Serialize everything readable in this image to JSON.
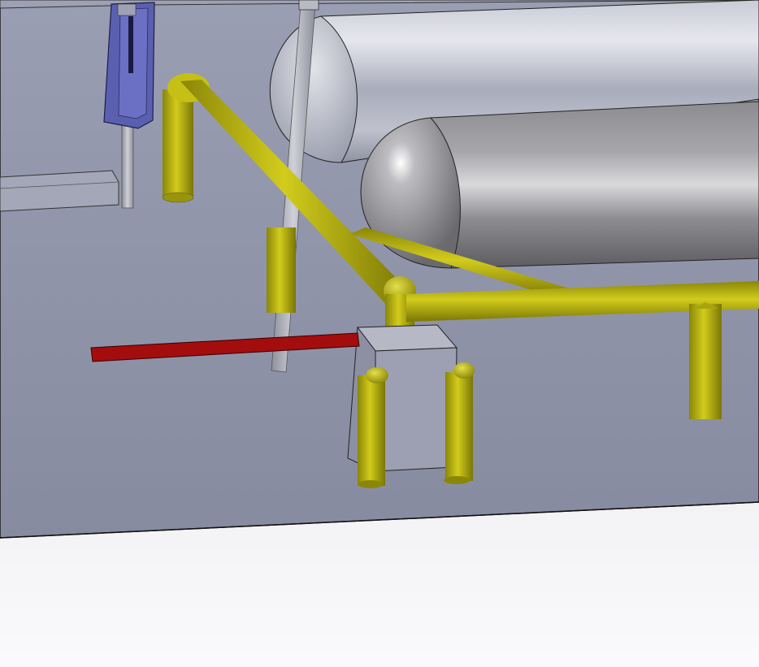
{
  "viewport": {
    "label": "",
    "background_top": "#dcdde3",
    "background_bottom": "#fafafc"
  },
  "colors": {
    "floor": "#8e93a8",
    "floor_edge": "#1a1a1a",
    "tank_light": "#aeb1c0",
    "tank_dark": "#6e6e72",
    "pipe_yellow": "#b8b30a",
    "pipe_yellow_dark": "#7c7805",
    "red_bar": "#a40d0d",
    "blue_box": "#5a5fb0",
    "grey_box": "#9a9db0",
    "rail": "#a6a8b4"
  },
  "icons": [
    "cad-assembly-model"
  ]
}
